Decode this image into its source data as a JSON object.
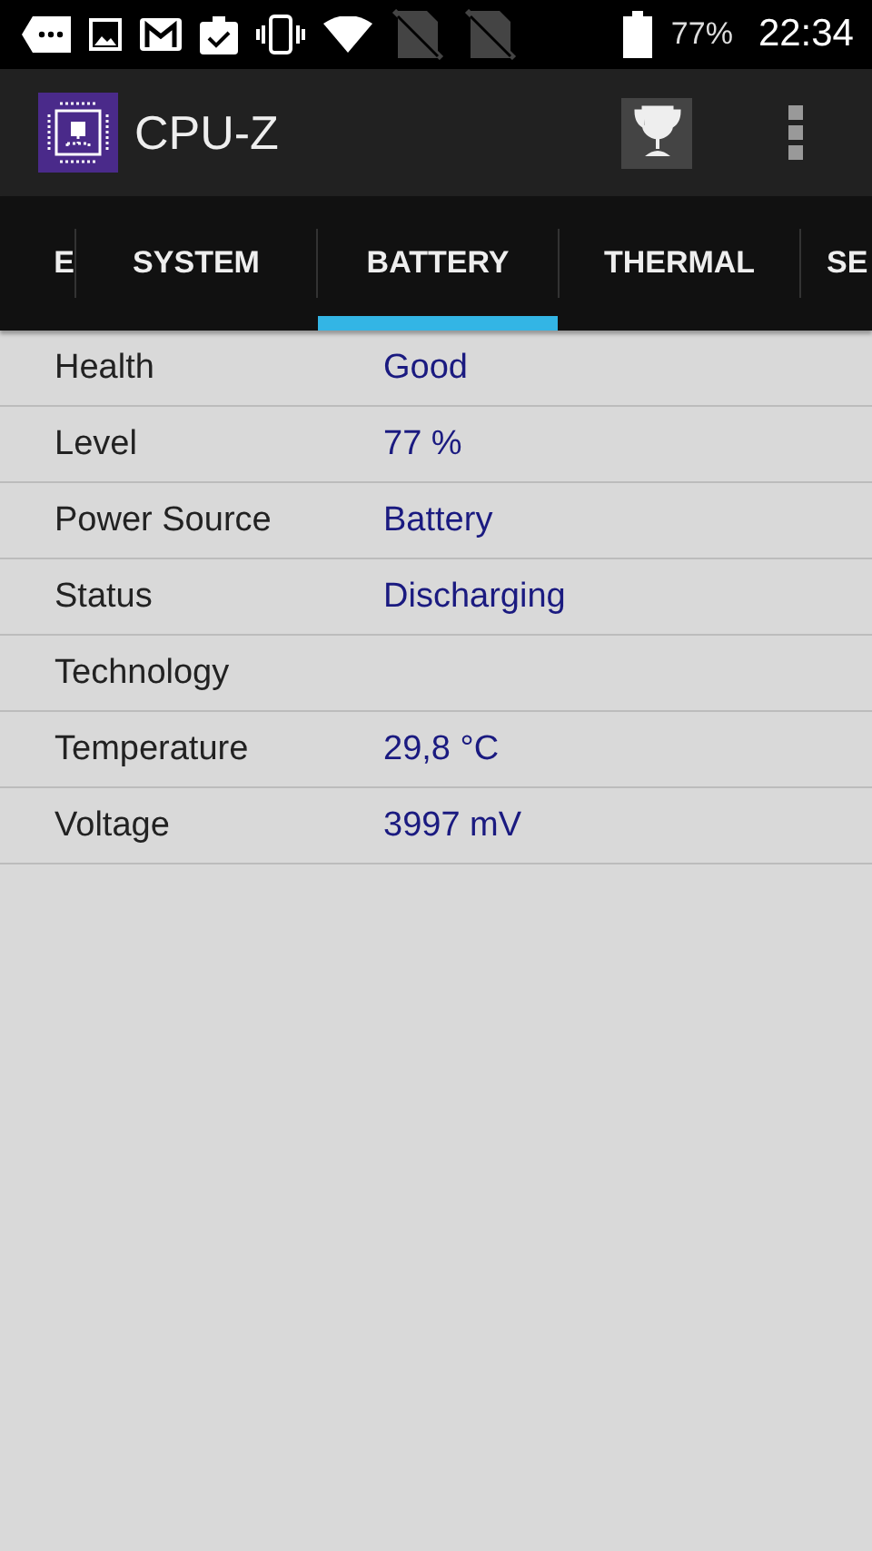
{
  "status_bar": {
    "battery_percent": "77%",
    "time": "22:34"
  },
  "app_bar": {
    "title": "CPU-Z"
  },
  "tabs": [
    {
      "label": "E",
      "selected": false
    },
    {
      "label": "SYSTEM",
      "selected": false
    },
    {
      "label": "BATTERY",
      "selected": true
    },
    {
      "label": "THERMAL",
      "selected": false
    },
    {
      "label": "SE",
      "selected": false
    }
  ],
  "rows": [
    {
      "label": "Health",
      "value": "Good"
    },
    {
      "label": "Level",
      "value": "77 %"
    },
    {
      "label": "Power Source",
      "value": "Battery"
    },
    {
      "label": "Status",
      "value": "Discharging"
    },
    {
      "label": "Technology"
    },
    {
      "label": "Temperature",
      "value": "29,8 °C"
    },
    {
      "label": "Voltage",
      "value": "3997 mV"
    }
  ]
}
